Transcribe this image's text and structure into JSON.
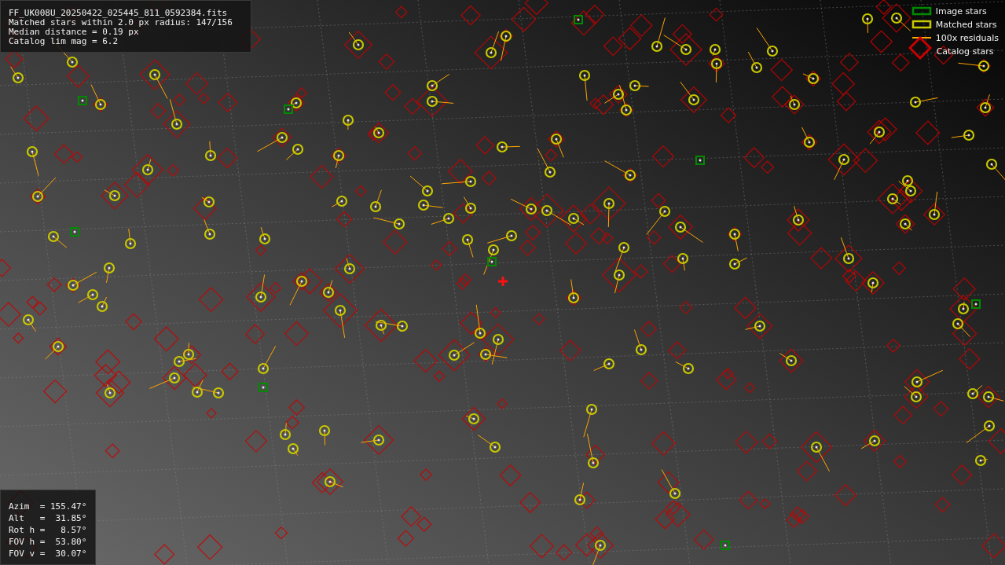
{
  "plot": {
    "info_lines": [
      "FF_UK008U_20250422_025445_811_0592384.fits",
      "Matched stars within 2.0 px radius: 147/156",
      "Median distance = 0.19 px",
      "Catalog lim mag = 6.2"
    ],
    "legend": [
      {
        "kind": "image",
        "label": "Image stars",
        "color": "#008a00"
      },
      {
        "kind": "matched",
        "label": "Matched stars",
        "color": "#c8c800"
      },
      {
        "kind": "residual",
        "label": "100x residuals",
        "color": "#ffa500"
      },
      {
        "kind": "catalog",
        "label": "Catalog stars",
        "color": "#c80000"
      }
    ],
    "pointing_lines": [
      "Azim  = 155.47°",
      "Alt   =  31.85°",
      "Rot h =   8.57°",
      "FOV h =  53.80°",
      "FOV v =  30.07°"
    ]
  }
}
